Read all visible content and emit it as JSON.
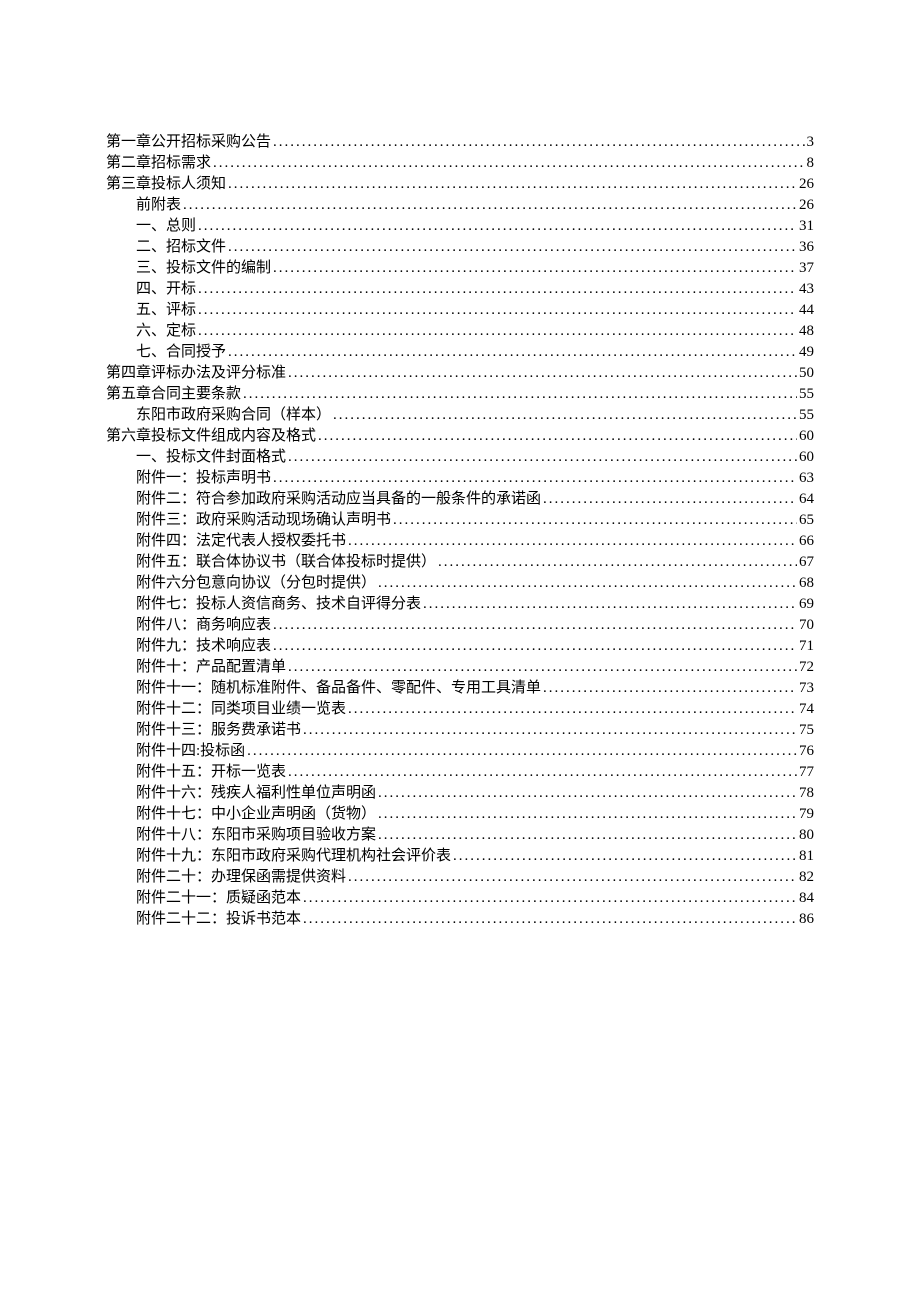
{
  "toc": [
    {
      "label": "第一章公开招标采购公告",
      "page": "3",
      "indent": false
    },
    {
      "label": "第二章招标需求",
      "page": "8",
      "indent": false
    },
    {
      "label": "第三章投标人须知",
      "page": "26",
      "indent": false
    },
    {
      "label": "前附表",
      "page": "26",
      "indent": true
    },
    {
      "label": "一、总则",
      "page": "31",
      "indent": true
    },
    {
      "label": "二、招标文件",
      "page": "36",
      "indent": true
    },
    {
      "label": "三、投标文件的编制",
      "page": "37",
      "indent": true
    },
    {
      "label": "四、开标",
      "page": "43",
      "indent": true
    },
    {
      "label": "五、评标",
      "page": "44",
      "indent": true
    },
    {
      "label": "六、定标",
      "page": "48",
      "indent": true
    },
    {
      "label": "七、合同授予",
      "page": "49",
      "indent": true
    },
    {
      "label": "第四章评标办法及评分标准",
      "page": "50",
      "indent": false
    },
    {
      "label": "第五章合同主要条款",
      "page": "55",
      "indent": false
    },
    {
      "label": "东阳市政府采购合同（样本）",
      "page": "55",
      "indent": true
    },
    {
      "label": "第六章投标文件组成内容及格式",
      "page": "60",
      "indent": false
    },
    {
      "label": "一、投标文件封面格式",
      "page": "60",
      "indent": true
    },
    {
      "label": "附件一：投标声明书",
      "page": "63",
      "indent": true
    },
    {
      "label": "附件二：符合参加政府采购活动应当具备的一般条件的承诺函",
      "page": "64",
      "indent": true
    },
    {
      "label": "附件三：政府采购活动现场确认声明书",
      "page": "65",
      "indent": true
    },
    {
      "label": "附件四：法定代表人授权委托书",
      "page": "66",
      "indent": true
    },
    {
      "label": "附件五：联合体协议书（联合体投标时提供）",
      "page": "67",
      "indent": true
    },
    {
      "label": "附件六分包意向协议（分包时提供）",
      "page": "68",
      "indent": true
    },
    {
      "label": "附件七：投标人资信商务、技术自评得分表",
      "page": "69",
      "indent": true
    },
    {
      "label": "附件八：商务响应表",
      "page": "70",
      "indent": true
    },
    {
      "label": "附件九：技术响应表",
      "page": "71",
      "indent": true
    },
    {
      "label": "附件十：产品配置清单",
      "page": "72",
      "indent": true
    },
    {
      "label": "附件十一：随机标准附件、备品备件、零配件、专用工具清单",
      "page": "73",
      "indent": true
    },
    {
      "label": "附件十二：同类项目业绩一览表",
      "page": "74",
      "indent": true
    },
    {
      "label": "附件十三：服务费承诺书",
      "page": "75",
      "indent": true
    },
    {
      "label": "附件十四:投标函",
      "page": "76",
      "indent": true
    },
    {
      "label": "附件十五：开标一览表",
      "page": "77",
      "indent": true
    },
    {
      "label": "附件十六：残疾人福利性单位声明函",
      "page": "78",
      "indent": true
    },
    {
      "label": "附件十七：中小企业声明函（货物）",
      "page": "79",
      "indent": true
    },
    {
      "label": "附件十八：东阳市采购项目验收方案",
      "page": "80",
      "indent": true
    },
    {
      "label": "附件十九：东阳市政府采购代理机构社会评价表",
      "page": "81",
      "indent": true
    },
    {
      "label": "附件二十：办理保函需提供资料",
      "page": "82",
      "indent": true
    },
    {
      "label": "附件二十一：质疑函范本",
      "page": "84",
      "indent": true
    },
    {
      "label": "附件二十二：投诉书范本",
      "page": "86",
      "indent": true
    }
  ]
}
